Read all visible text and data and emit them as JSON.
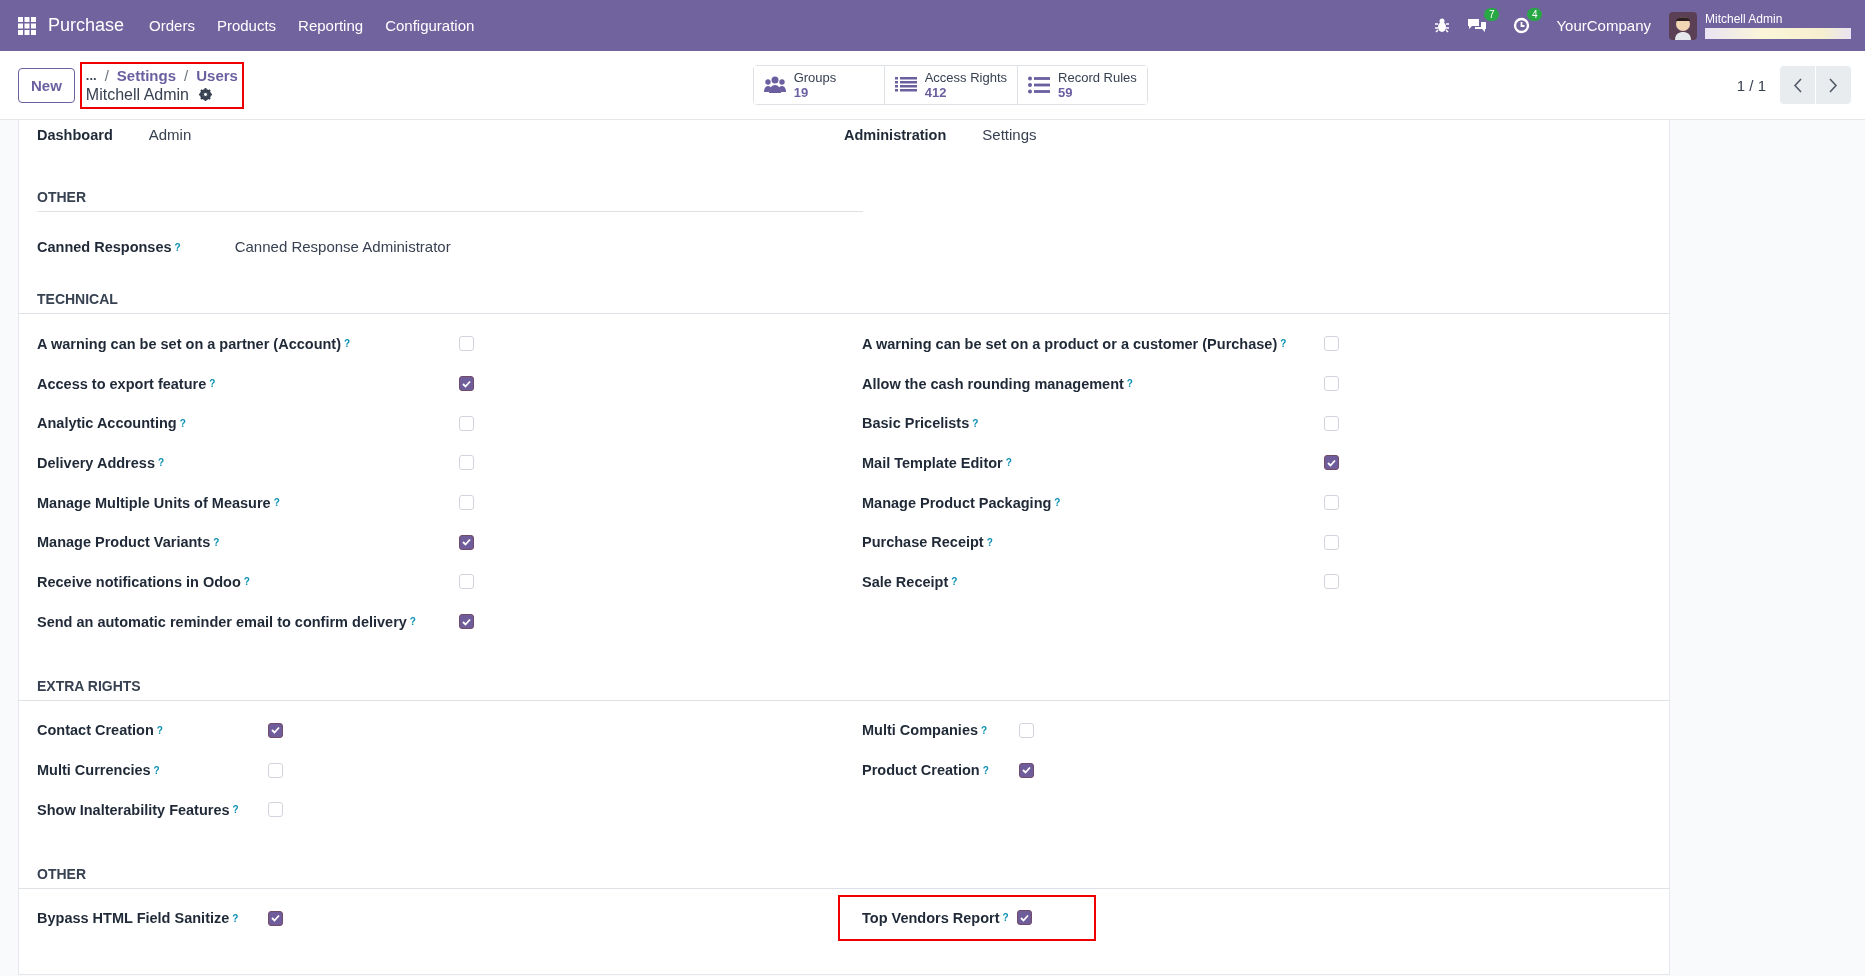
{
  "navbar": {
    "app": "Purchase",
    "menu": [
      "Orders",
      "Products",
      "Reporting",
      "Configuration"
    ],
    "messages_count": "7",
    "activities_count": "4",
    "company": "YourCompany",
    "user": "Mitchell Admin"
  },
  "control_panel": {
    "new_button": "New",
    "breadcrumb": {
      "ellipsis": "...",
      "items": [
        {
          "separator": "/",
          "label": "Settings"
        },
        {
          "separator": "/",
          "label": "Users"
        }
      ],
      "record": "Mitchell Admin",
      "highlighted": true
    },
    "stat_buttons": [
      {
        "kind": "users",
        "label": "Groups",
        "value": "19"
      },
      {
        "kind": "list",
        "label": "Access Rights",
        "value": "412"
      },
      {
        "kind": "bullets",
        "label": "Record Rules",
        "value": "59"
      }
    ],
    "pager": "1 / 1"
  },
  "top_fields": [
    {
      "label": "Dashboard",
      "value": "Admin"
    },
    {
      "label": "Administration",
      "value": "Settings"
    }
  ],
  "sections": [
    {
      "kind": "selection",
      "title": "OTHER",
      "fields": [
        {
          "label": "Canned Responses",
          "help": "?",
          "value": "Canned Response Administrator"
        }
      ]
    },
    {
      "kind": "checkboxes",
      "title": "TECHNICAL",
      "columns": [
        [
          {
            "label": "A warning can be set on a partner (Account)",
            "help": "?",
            "checked": false
          },
          {
            "label": "Access to export feature",
            "help": "?",
            "checked": true
          },
          {
            "label": "Analytic Accounting",
            "help": "?",
            "checked": false
          },
          {
            "label": "Delivery Address",
            "help": "?",
            "checked": false
          },
          {
            "label": "Manage Multiple Units of Measure",
            "help": "?",
            "checked": false
          },
          {
            "label": "Manage Product Variants",
            "help": "?",
            "checked": true
          },
          {
            "label": "Receive notifications in Odoo",
            "help": "?",
            "checked": false
          },
          {
            "label": "Send an automatic reminder email to confirm delivery",
            "help": "?",
            "checked": true
          }
        ],
        [
          {
            "label": "A warning can be set on a product or a customer (Purchase)",
            "help": "?",
            "checked": false
          },
          {
            "label": "Allow the cash rounding management",
            "help": "?",
            "checked": false
          },
          {
            "label": "Basic Pricelists",
            "help": "?",
            "checked": false
          },
          {
            "label": "Mail Template Editor",
            "help": "?",
            "checked": true
          },
          {
            "label": "Manage Product Packaging",
            "help": "?",
            "checked": false
          },
          {
            "label": "Purchase Receipt",
            "help": "?",
            "checked": false
          },
          {
            "label": "Sale Receipt",
            "help": "?",
            "checked": false
          }
        ]
      ]
    },
    {
      "kind": "checkboxes-compact",
      "title": "EXTRA RIGHTS",
      "columns": [
        [
          {
            "label": "Contact Creation",
            "help": "?",
            "checked": true
          },
          {
            "label": "Multi Currencies",
            "help": "?",
            "checked": false
          },
          {
            "label": "Show Inalterability Features",
            "help": "?",
            "checked": false
          }
        ],
        [
          {
            "label": "Multi Companies",
            "help": "?",
            "checked": false
          },
          {
            "label": "Product Creation",
            "help": "?",
            "checked": true
          }
        ]
      ]
    },
    {
      "kind": "checkboxes-compact",
      "title": "OTHER",
      "columns": [
        [
          {
            "label": "Bypass HTML Field Sanitize",
            "help": "?",
            "checked": true
          }
        ],
        [
          {
            "label": "Top Vendors Report",
            "help": "?",
            "checked": true,
            "highlighted": true
          }
        ]
      ]
    }
  ]
}
